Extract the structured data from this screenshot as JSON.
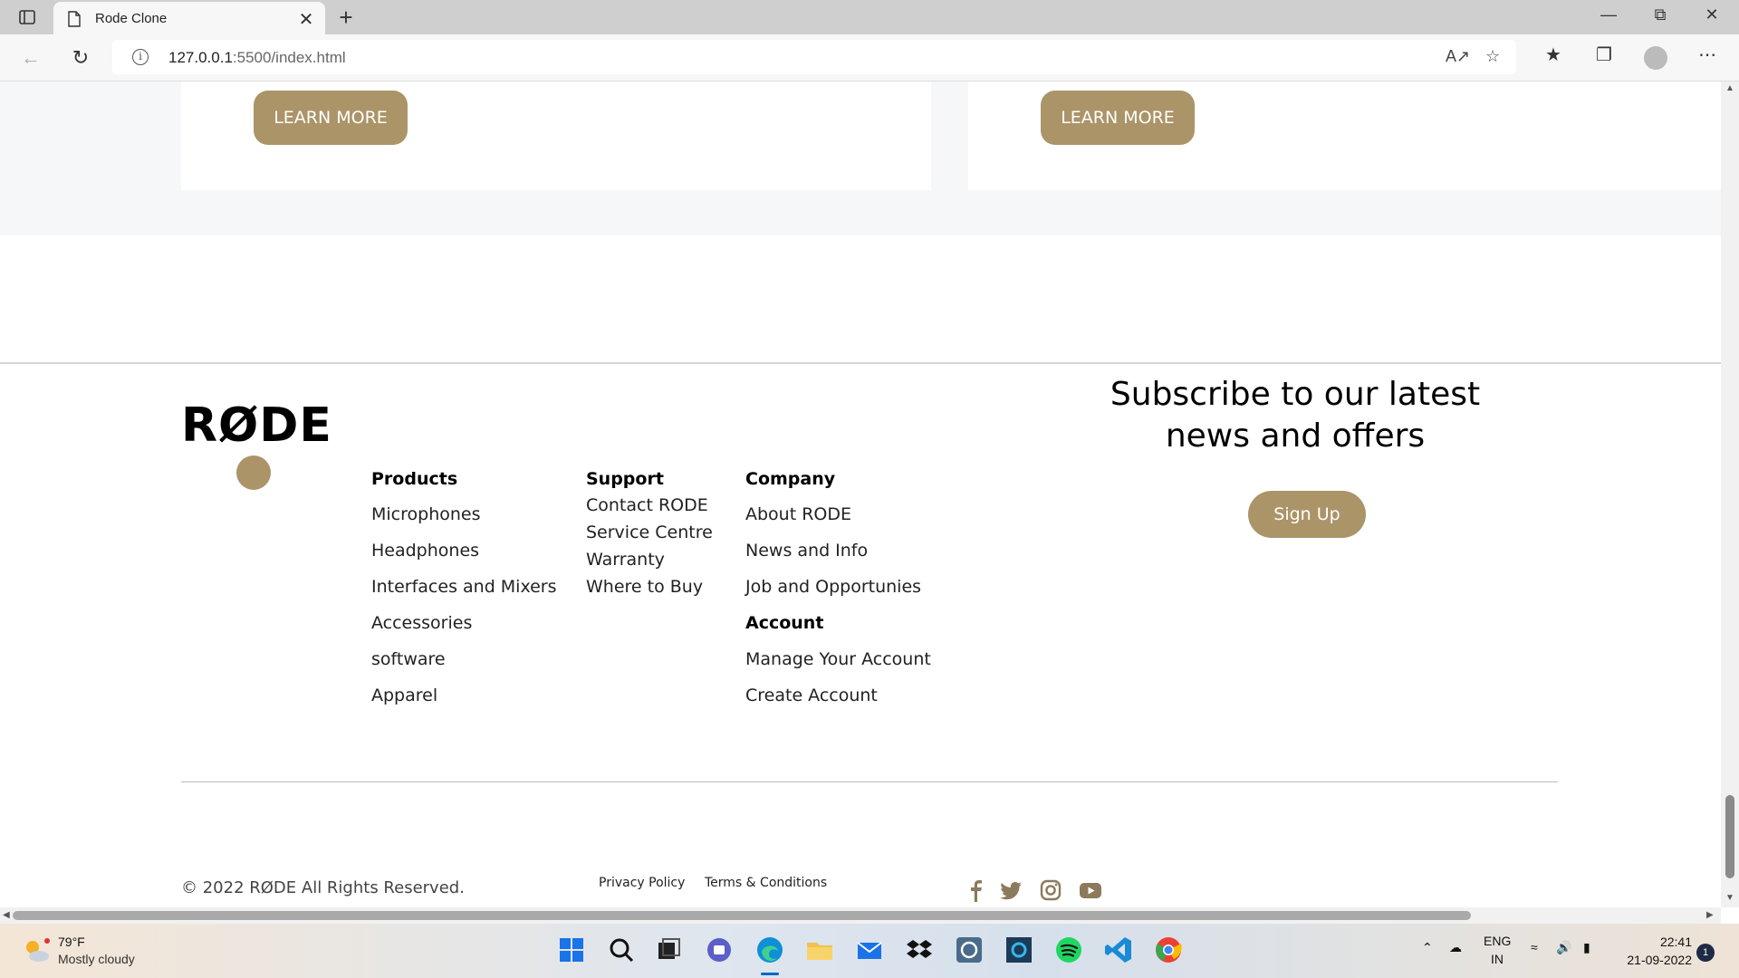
{
  "browser": {
    "tab_title": "Rode Clone",
    "url_host": "127.0.0.1",
    "url_rest": ":5500/index.html",
    "new_tab": "+",
    "close": "✕"
  },
  "cards": {
    "learn_more_label": "LEARN MORE"
  },
  "footer": {
    "logo": "RØDE",
    "products": {
      "heading": "Products",
      "links": [
        "Microphones",
        "Headphones",
        "Interfaces and Mixers",
        "Accessories",
        "software",
        "Apparel"
      ]
    },
    "support": {
      "heading": "Support",
      "links": [
        "Contact RODE",
        "Service Centre",
        "Warranty",
        "Where to Buy"
      ]
    },
    "company": {
      "heading": "Company",
      "links": [
        "About RODE",
        "News and Info",
        "Job and Opportunies"
      ]
    },
    "account": {
      "heading": "Account",
      "links": [
        "Manage Your Account",
        "Create Account"
      ]
    },
    "subscribe": {
      "line1": "Subscribe to our latest",
      "line2": "news and offers",
      "button": "Sign Up"
    },
    "copyright": "© 2022 RØDE All Rights Reserved.",
    "privacy": "Privacy Policy",
    "terms": "Terms & Conditions",
    "social_icons": [
      "facebook-icon",
      "twitter-icon",
      "instagram-icon",
      "youtube-icon"
    ]
  },
  "taskbar": {
    "temperature": "79°F",
    "weather": "Mostly cloudy",
    "lang1": "ENG",
    "lang2": "IN",
    "time": "22:41",
    "date": "21-09-2022",
    "notifications": "1"
  },
  "colors": {
    "accent": "#ab9468"
  }
}
